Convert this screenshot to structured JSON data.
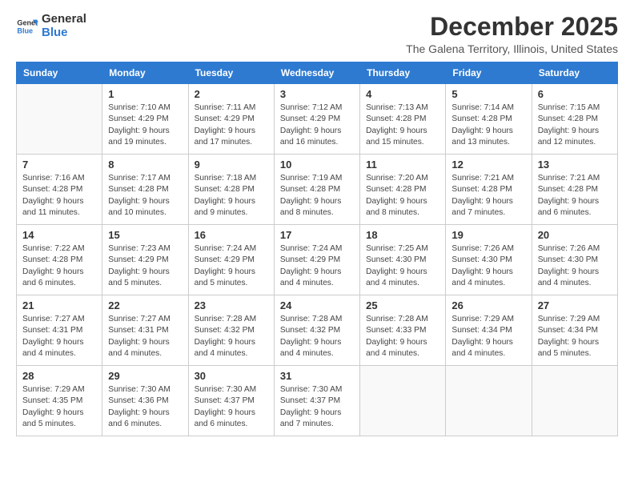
{
  "logo": {
    "text_general": "General",
    "text_blue": "Blue"
  },
  "title": "December 2025",
  "location": "The Galena Territory, Illinois, United States",
  "weekdays": [
    "Sunday",
    "Monday",
    "Tuesday",
    "Wednesday",
    "Thursday",
    "Friday",
    "Saturday"
  ],
  "weeks": [
    [
      {
        "day": null
      },
      {
        "day": 1,
        "sunrise": "7:10 AM",
        "sunset": "4:29 PM",
        "daylight": "9 hours and 19 minutes."
      },
      {
        "day": 2,
        "sunrise": "7:11 AM",
        "sunset": "4:29 PM",
        "daylight": "9 hours and 17 minutes."
      },
      {
        "day": 3,
        "sunrise": "7:12 AM",
        "sunset": "4:29 PM",
        "daylight": "9 hours and 16 minutes."
      },
      {
        "day": 4,
        "sunrise": "7:13 AM",
        "sunset": "4:28 PM",
        "daylight": "9 hours and 15 minutes."
      },
      {
        "day": 5,
        "sunrise": "7:14 AM",
        "sunset": "4:28 PM",
        "daylight": "9 hours and 13 minutes."
      },
      {
        "day": 6,
        "sunrise": "7:15 AM",
        "sunset": "4:28 PM",
        "daylight": "9 hours and 12 minutes."
      }
    ],
    [
      {
        "day": 7,
        "sunrise": "7:16 AM",
        "sunset": "4:28 PM",
        "daylight": "9 hours and 11 minutes."
      },
      {
        "day": 8,
        "sunrise": "7:17 AM",
        "sunset": "4:28 PM",
        "daylight": "9 hours and 10 minutes."
      },
      {
        "day": 9,
        "sunrise": "7:18 AM",
        "sunset": "4:28 PM",
        "daylight": "9 hours and 9 minutes."
      },
      {
        "day": 10,
        "sunrise": "7:19 AM",
        "sunset": "4:28 PM",
        "daylight": "9 hours and 8 minutes."
      },
      {
        "day": 11,
        "sunrise": "7:20 AM",
        "sunset": "4:28 PM",
        "daylight": "9 hours and 8 minutes."
      },
      {
        "day": 12,
        "sunrise": "7:21 AM",
        "sunset": "4:28 PM",
        "daylight": "9 hours and 7 minutes."
      },
      {
        "day": 13,
        "sunrise": "7:21 AM",
        "sunset": "4:28 PM",
        "daylight": "9 hours and 6 minutes."
      }
    ],
    [
      {
        "day": 14,
        "sunrise": "7:22 AM",
        "sunset": "4:28 PM",
        "daylight": "9 hours and 6 minutes."
      },
      {
        "day": 15,
        "sunrise": "7:23 AM",
        "sunset": "4:29 PM",
        "daylight": "9 hours and 5 minutes."
      },
      {
        "day": 16,
        "sunrise": "7:24 AM",
        "sunset": "4:29 PM",
        "daylight": "9 hours and 5 minutes."
      },
      {
        "day": 17,
        "sunrise": "7:24 AM",
        "sunset": "4:29 PM",
        "daylight": "9 hours and 4 minutes."
      },
      {
        "day": 18,
        "sunrise": "7:25 AM",
        "sunset": "4:30 PM",
        "daylight": "9 hours and 4 minutes."
      },
      {
        "day": 19,
        "sunrise": "7:26 AM",
        "sunset": "4:30 PM",
        "daylight": "9 hours and 4 minutes."
      },
      {
        "day": 20,
        "sunrise": "7:26 AM",
        "sunset": "4:30 PM",
        "daylight": "9 hours and 4 minutes."
      }
    ],
    [
      {
        "day": 21,
        "sunrise": "7:27 AM",
        "sunset": "4:31 PM",
        "daylight": "9 hours and 4 minutes."
      },
      {
        "day": 22,
        "sunrise": "7:27 AM",
        "sunset": "4:31 PM",
        "daylight": "9 hours and 4 minutes."
      },
      {
        "day": 23,
        "sunrise": "7:28 AM",
        "sunset": "4:32 PM",
        "daylight": "9 hours and 4 minutes."
      },
      {
        "day": 24,
        "sunrise": "7:28 AM",
        "sunset": "4:32 PM",
        "daylight": "9 hours and 4 minutes."
      },
      {
        "day": 25,
        "sunrise": "7:28 AM",
        "sunset": "4:33 PM",
        "daylight": "9 hours and 4 minutes."
      },
      {
        "day": 26,
        "sunrise": "7:29 AM",
        "sunset": "4:34 PM",
        "daylight": "9 hours and 4 minutes."
      },
      {
        "day": 27,
        "sunrise": "7:29 AM",
        "sunset": "4:34 PM",
        "daylight": "9 hours and 5 minutes."
      }
    ],
    [
      {
        "day": 28,
        "sunrise": "7:29 AM",
        "sunset": "4:35 PM",
        "daylight": "9 hours and 5 minutes."
      },
      {
        "day": 29,
        "sunrise": "7:30 AM",
        "sunset": "4:36 PM",
        "daylight": "9 hours and 6 minutes."
      },
      {
        "day": 30,
        "sunrise": "7:30 AM",
        "sunset": "4:37 PM",
        "daylight": "9 hours and 6 minutes."
      },
      {
        "day": 31,
        "sunrise": "7:30 AM",
        "sunset": "4:37 PM",
        "daylight": "9 hours and 7 minutes."
      },
      {
        "day": null
      },
      {
        "day": null
      },
      {
        "day": null
      }
    ]
  ]
}
